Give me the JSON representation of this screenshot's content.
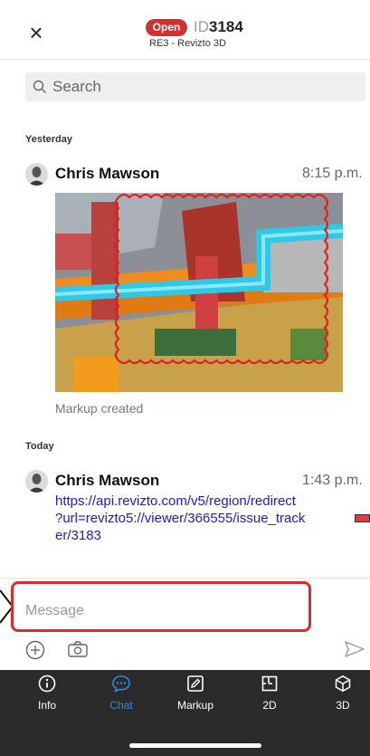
{
  "header": {
    "close_label": "×",
    "status_badge": "Open",
    "id_prefix": "ID",
    "id_number": "3184",
    "subtitle": "RE3 - Revizto 3D"
  },
  "search": {
    "placeholder": "Search"
  },
  "feed": [
    {
      "date_label": "Yesterday",
      "author": "Chris Mawson",
      "time": "8:15 p.m.",
      "caption": "Markup created"
    },
    {
      "date_label": "Today",
      "author": "Chris Mawson",
      "time": "1:43 p.m.",
      "link_lines": [
        "https://api.revizto.com/v5/region/redirect",
        "?url=revizto5://viewer/366555/issue_track",
        "er/3183"
      ]
    }
  ],
  "composer": {
    "placeholder": "Message"
  },
  "tabbar": {
    "active": "Chat",
    "tabs": [
      {
        "label": "Info",
        "icon": "info-icon"
      },
      {
        "label": "Chat",
        "icon": "chat-bubble-icon"
      },
      {
        "label": "Markup",
        "icon": "pencil-box-icon"
      },
      {
        "label": "2D",
        "icon": "floorplan-icon"
      },
      {
        "label": "3D",
        "icon": "cube-icon"
      }
    ]
  },
  "colors": {
    "badge_red": "#d32f2f",
    "link_blue": "#1a1ad8",
    "active_tab_blue": "#2b8ae6",
    "tabbar_bg": "#2b2b2b",
    "annotation_red": "#e02020"
  }
}
